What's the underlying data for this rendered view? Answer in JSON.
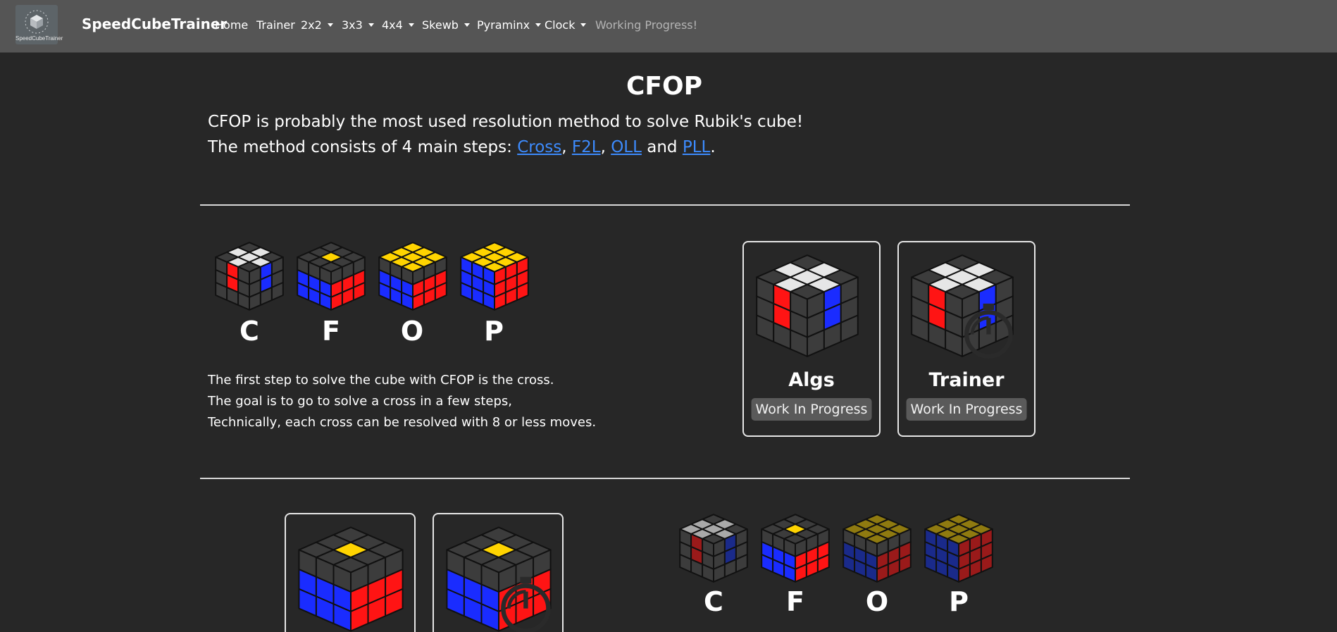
{
  "navbar": {
    "logo_text": "SpeedCubeTrainer",
    "brand": "SpeedCubeTrainer",
    "links": {
      "home": "Home",
      "trainer": "Trainer",
      "2x2": "2x2",
      "3x3": "3x3",
      "4x4": "4x4",
      "skewb": "Skewb",
      "pyraminx": "Pyraminx",
      "clock": "Clock",
      "working": "Working Progress!"
    }
  },
  "main": {
    "title": "CFOP",
    "intro_line1": "CFOP is probably the most used resolution method to solve Rubik's cube!",
    "intro_line2_prefix": "The method consists of 4 main steps: ",
    "steps": [
      "Cross",
      "F2L",
      "OLL",
      "PLL"
    ],
    "sep1": ",",
    "sep2": ",",
    "and_text": " and ",
    "period": "."
  },
  "cross_section": {
    "letters": [
      "C",
      "F",
      "O",
      "P"
    ],
    "desc": [
      "The first step to solve the cube with CFOP is the cross.",
      "The goal is to go to solve a cross in a few steps,",
      "Technically, each cross can be resolved with 8 or less moves."
    ],
    "cards": [
      {
        "title": "Algs",
        "button": "Work In Progress",
        "icon": "algs-cube-icon"
      },
      {
        "title": "Trainer",
        "button": "Work In Progress",
        "icon": "trainer-cube-timer-icon"
      }
    ]
  },
  "f2l_section": {
    "letters": [
      "C",
      "F",
      "O",
      "P"
    ]
  },
  "colors": {
    "navbar": "#555555",
    "background": "#272727",
    "link": "#3d8bfd",
    "button": "#5a5a5a",
    "cube_red": "#ff1414",
    "cube_blue": "#1a2cff",
    "cube_white": "#e6e6e6",
    "cube_yellow": "#ffd400",
    "cube_gray": "#3c3c3c"
  }
}
